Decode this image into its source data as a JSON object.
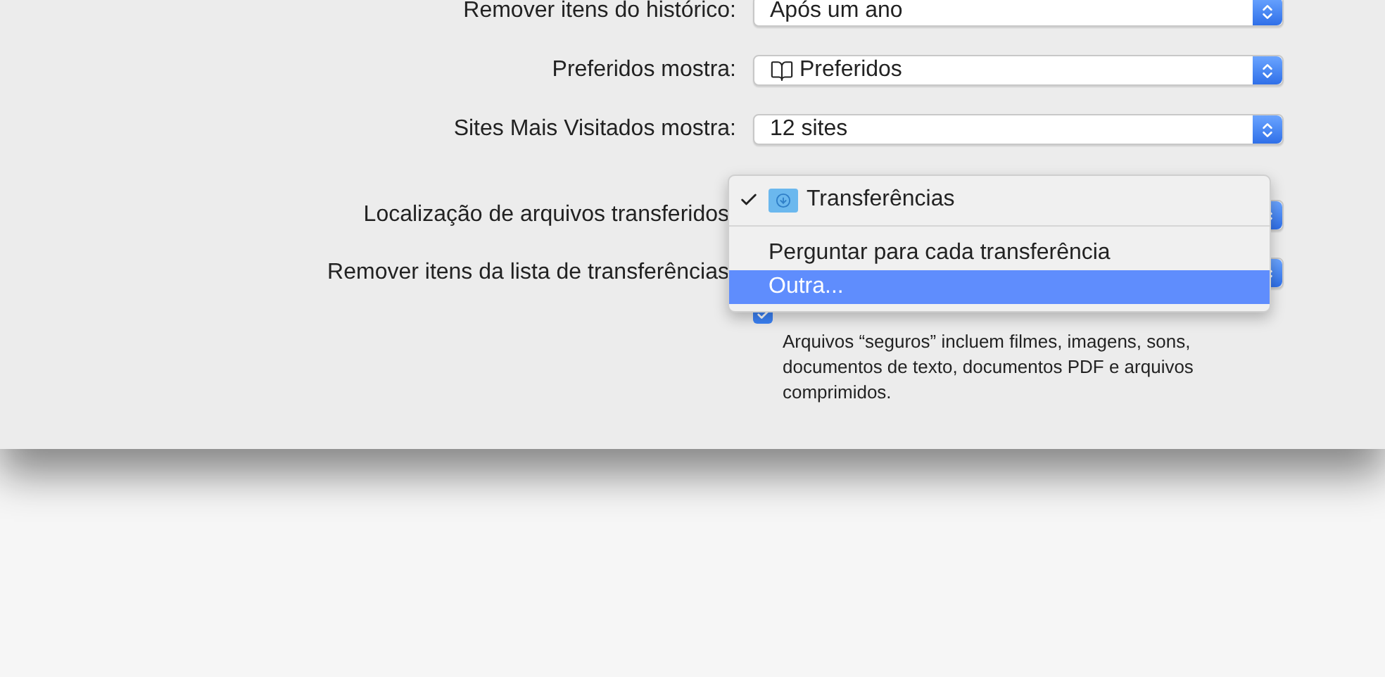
{
  "settings": [
    {
      "label": "Remover itens do histórico:",
      "value": "Após um ano",
      "kind": "plain"
    },
    {
      "label": "Preferidos mostra:",
      "value": "Preferidos",
      "kind": "bookmarks"
    },
    {
      "label": "Sites Mais Visitados mostra:",
      "value": "12 sites",
      "kind": "plain"
    }
  ],
  "download_settings": [
    {
      "label": "Localização de arquivos transferidos"
    },
    {
      "label": "Remover itens da lista de transferências"
    }
  ],
  "open_safe_files": {
    "checked": true,
    "note": "Arquivos “seguros” incluem filmes, imagens, sons, documentos de texto, documentos PDF e arquivos comprimidos."
  },
  "menu": {
    "groups": [
      [
        {
          "label": "Transferências",
          "checked": true,
          "selected": false,
          "kind": "folder"
        }
      ],
      [
        {
          "label": "Perguntar para cada transferência",
          "checked": false,
          "selected": false,
          "kind": "plain"
        },
        {
          "label": "Outra...",
          "checked": false,
          "selected": true,
          "kind": "plain"
        }
      ]
    ]
  }
}
